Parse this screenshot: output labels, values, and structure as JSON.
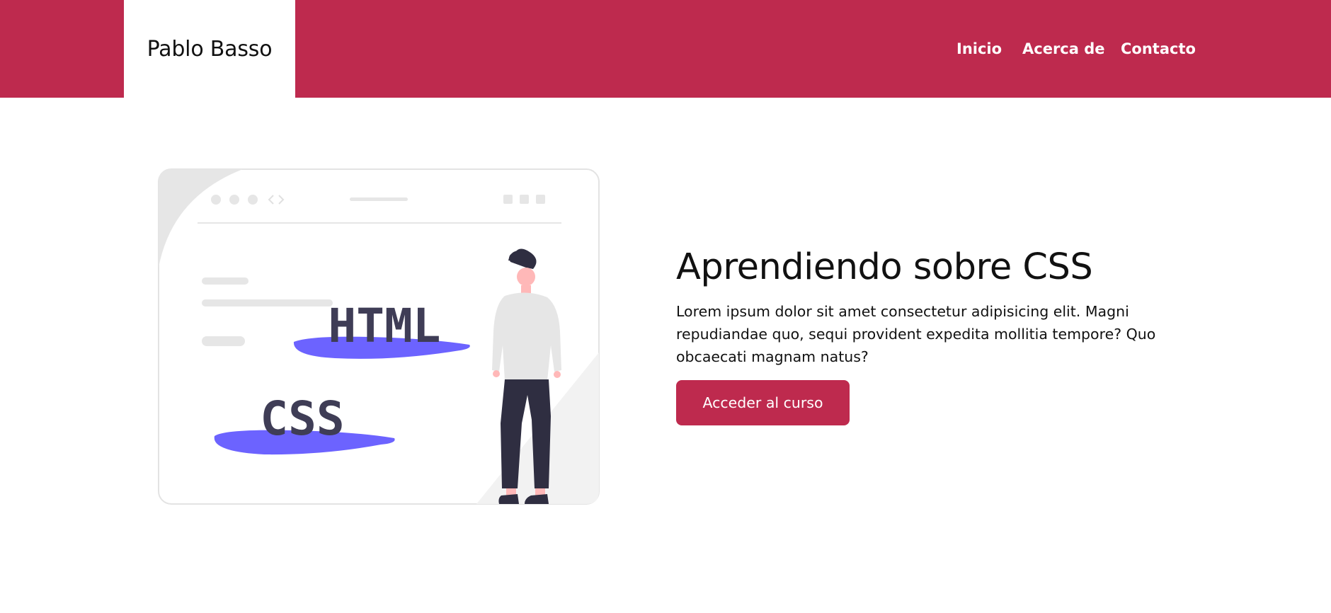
{
  "header": {
    "brand": "Pablo Basso",
    "nav": [
      "Inicio",
      "Acerca de",
      "Contacto"
    ]
  },
  "illustration": {
    "tag_html": "HTML",
    "tag_css": "CSS"
  },
  "hero": {
    "title": "Aprendiendo sobre CSS",
    "text": "Lorem ipsum dolor sit amet consectetur adipisicing elit. Magni repudiandae quo, sequi provident expedita mollitia tempore? Quo obcaecati magnam natus?",
    "button": "Acceder al curso"
  },
  "colors": {
    "accent": "#be2a4e",
    "blob": "#6c63ff",
    "dark": "#2f2e41"
  }
}
